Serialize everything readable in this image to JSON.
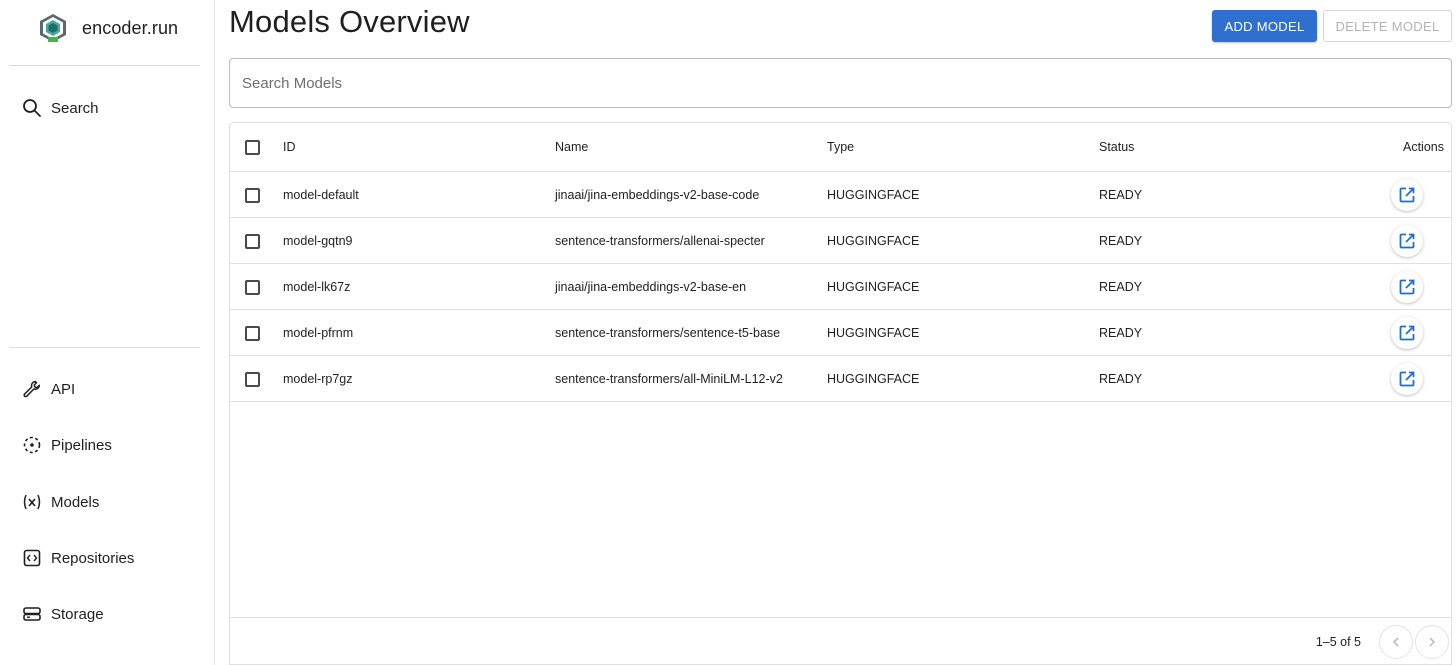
{
  "app": {
    "brand_name": "encoder.run"
  },
  "sidebar": {
    "top_items": [
      {
        "label": "Search",
        "icon": "search-icon"
      }
    ],
    "bottom_items": [
      {
        "label": "API",
        "icon": "wrench-icon"
      },
      {
        "label": "Pipelines",
        "icon": "pipelines-icon"
      },
      {
        "label": "Models",
        "icon": "function-variable-icon"
      },
      {
        "label": "Repositories",
        "icon": "code-box-icon"
      },
      {
        "label": "Storage",
        "icon": "storage-icon"
      }
    ]
  },
  "header": {
    "title": "Models Overview",
    "add_label": "ADD MODEL",
    "delete_label": "DELETE MODEL"
  },
  "search": {
    "placeholder": "Search Models",
    "value": ""
  },
  "table": {
    "columns": [
      "ID",
      "Name",
      "Type",
      "Status",
      "Actions"
    ],
    "rows": [
      {
        "id": "model-default",
        "name": "jinaai/jina-embeddings-v2-base-code",
        "type": "HUGGINGFACE",
        "status": "READY"
      },
      {
        "id": "model-gqtn9",
        "name": "sentence-transformers/allenai-specter",
        "type": "HUGGINGFACE",
        "status": "READY"
      },
      {
        "id": "model-lk67z",
        "name": "jinaai/jina-embeddings-v2-base-en",
        "type": "HUGGINGFACE",
        "status": "READY"
      },
      {
        "id": "model-pfrnm",
        "name": "sentence-transformers/sentence-t5-base",
        "type": "HUGGINGFACE",
        "status": "READY"
      },
      {
        "id": "model-rp7gz",
        "name": "sentence-transformers/all-MiniLM-L12-v2",
        "type": "HUGGINGFACE",
        "status": "READY"
      }
    ],
    "action_icon": "open-in-new-icon"
  },
  "pagination": {
    "range_text": "1–5 of 5"
  },
  "colors": {
    "primary": "#2f6fcf",
    "action_icon": "#1f6fd1",
    "disabled_text": "#b3b3b3"
  }
}
